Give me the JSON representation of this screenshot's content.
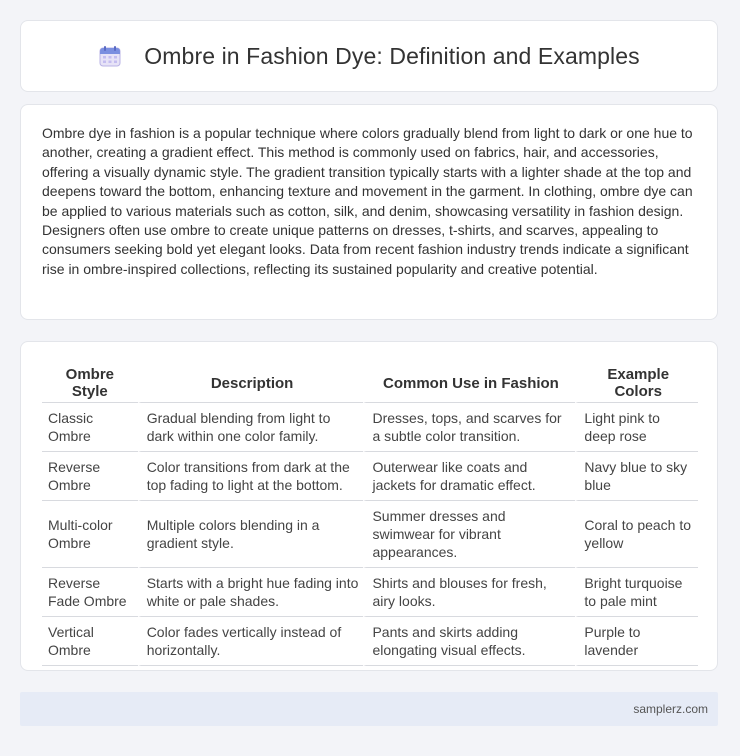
{
  "header": {
    "icon": "calendar-icon",
    "title": "Ombre in Fashion Dye: Definition and Examples"
  },
  "intro": {
    "text": "Ombre dye in fashion is a popular technique where colors gradually blend from light to dark or one hue to another, creating a gradient effect. This method is commonly used on fabrics, hair, and accessories, offering a visually dynamic style. The gradient transition typically starts with a lighter shade at the top and deepens toward the bottom, enhancing texture and movement in the garment. In clothing, ombre dye can be applied to various materials such as cotton, silk, and denim, showcasing versatility in fashion design. Designers often use ombre to create unique patterns on dresses, t-shirts, and scarves, appealing to consumers seeking bold yet elegant looks. Data from recent fashion industry trends indicate a significant rise in ombre-inspired collections, reflecting its sustained popularity and creative potential."
  },
  "table": {
    "headers": [
      "Ombre Style",
      "Description",
      "Common Use in Fashion",
      "Example Colors"
    ],
    "rows": [
      [
        "Classic Ombre",
        "Gradual blending from light to dark within one color family.",
        "Dresses, tops, and scarves for a subtle color transition.",
        "Light pink to deep rose"
      ],
      [
        "Reverse Ombre",
        "Color transitions from dark at the top fading to light at the bottom.",
        "Outerwear like coats and jackets for dramatic effect.",
        "Navy blue to sky blue"
      ],
      [
        "Multi-color Ombre",
        "Multiple colors blending in a gradient style.",
        "Summer dresses and swimwear for vibrant appearances.",
        "Coral to peach to yellow"
      ],
      [
        "Reverse Fade Ombre",
        "Starts with a bright hue fading into white or pale shades.",
        "Shirts and blouses for fresh, airy looks.",
        "Bright turquoise to pale mint"
      ],
      [
        "Vertical Ombre",
        "Color fades vertically instead of horizontally.",
        "Pants and skirts adding elongating visual effects.",
        "Purple to lavender"
      ]
    ]
  },
  "footer": {
    "site": "samplerz.com"
  },
  "colors": {
    "background": "#f3f4f8",
    "card": "#ffffff",
    "footer_bg": "#e6ebf6",
    "icon_accent": "#6e7fd6"
  }
}
